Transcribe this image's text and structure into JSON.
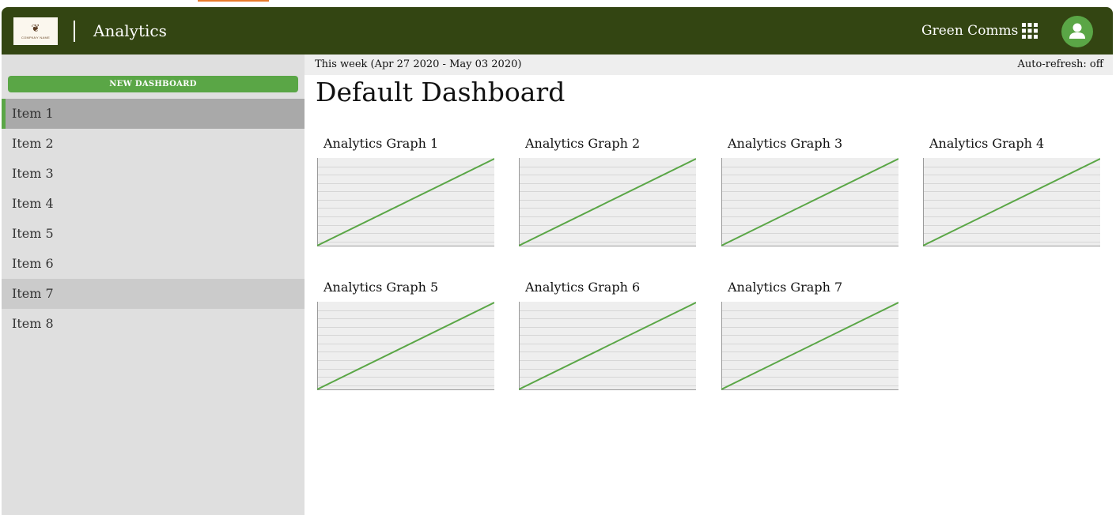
{
  "header": {
    "logo_text": "COMPANY NAME",
    "app_title": "Analytics",
    "org_name": "Green Comms"
  },
  "sidebar": {
    "new_dashboard_label": "NEW DASHBOARD",
    "items": [
      {
        "label": "Item 1",
        "state": "active"
      },
      {
        "label": "Item 2",
        "state": "normal"
      },
      {
        "label": "Item 3",
        "state": "normal"
      },
      {
        "label": "Item 4",
        "state": "normal"
      },
      {
        "label": "Item 5",
        "state": "normal"
      },
      {
        "label": "Item 6",
        "state": "normal"
      },
      {
        "label": "Item 7",
        "state": "hovered"
      },
      {
        "label": "Item 8",
        "state": "normal"
      }
    ]
  },
  "toolbar": {
    "date_range": "This week (Apr 27 2020 - May 03 2020)",
    "auto_refresh": "Auto-refresh: off"
  },
  "main": {
    "title": "Default Dashboard",
    "graphs": [
      {
        "title": "Analytics Graph 1"
      },
      {
        "title": "Analytics Graph 2"
      },
      {
        "title": "Analytics Graph 3"
      },
      {
        "title": "Analytics Graph 4"
      },
      {
        "title": "Analytics Graph 5"
      },
      {
        "title": "Analytics Graph 6"
      },
      {
        "title": "Analytics Graph 7"
      }
    ]
  },
  "colors": {
    "header_bg": "#334512",
    "accent": "#5aa646",
    "sidebar_bg": "#dfdfdf",
    "active_item_bg": "#a9a9a9",
    "graph_bg": "#eeeeee"
  },
  "icons": {
    "apps": "grid-icon",
    "avatar": "user-icon"
  }
}
